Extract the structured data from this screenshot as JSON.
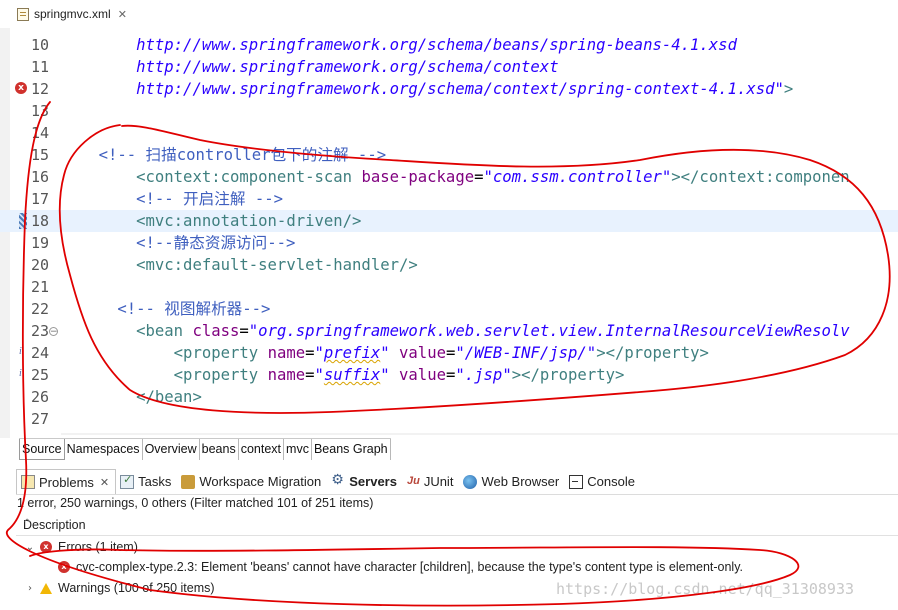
{
  "editor_tab": {
    "title": "springmvc.xml",
    "close": "✕"
  },
  "code_lines": [
    {
      "num": "10",
      "hl": false,
      "segs": [
        {
          "t": "        ",
          "c": "bl"
        },
        {
          "t": "http://www.springframework.org/schema/beans/spring-beans-4.1.xsd",
          "c": "url"
        }
      ]
    },
    {
      "num": "11",
      "hl": false,
      "segs": [
        {
          "t": "        ",
          "c": "bl"
        },
        {
          "t": "http://www.springframework.org/schema/context",
          "c": "url"
        }
      ]
    },
    {
      "num": "12",
      "hl": false,
      "segs": [
        {
          "t": "        ",
          "c": "bl"
        },
        {
          "t": "http://www.springframework.org/schema/context/spring-context-4.1.xsd\"",
          "c": "url"
        },
        {
          "t": ">",
          "c": "tag"
        }
      ]
    },
    {
      "num": "13",
      "hl": false,
      "segs": []
    },
    {
      "num": "14",
      "hl": false,
      "segs": []
    },
    {
      "num": "15",
      "hl": false,
      "segs": [
        {
          "t": "    ",
          "c": "bl"
        },
        {
          "t": "<!-- 扫描controller包下的注解 -->",
          "c": "cmt"
        }
      ]
    },
    {
      "num": "16",
      "hl": false,
      "segs": [
        {
          "t": "        ",
          "c": "bl"
        },
        {
          "t": "<context:component-scan ",
          "c": "tag"
        },
        {
          "t": "base-package",
          "c": "attr"
        },
        {
          "t": "=",
          "c": "bl"
        },
        {
          "t": "\"com.ssm.controller\"",
          "c": "str"
        },
        {
          "t": "></context:componen",
          "c": "tag"
        }
      ]
    },
    {
      "num": "17",
      "hl": false,
      "segs": [
        {
          "t": "        ",
          "c": "bl"
        },
        {
          "t": "<!-- 开启注解 -->",
          "c": "cmt"
        }
      ]
    },
    {
      "num": "18",
      "hl": true,
      "segs": [
        {
          "t": "        ",
          "c": "bl"
        },
        {
          "t": "<mvc:annotation-driven/>",
          "c": "tag"
        }
      ]
    },
    {
      "num": "19",
      "hl": false,
      "segs": [
        {
          "t": "        ",
          "c": "bl"
        },
        {
          "t": "<!--静态资源访问-->",
          "c": "cmt"
        }
      ]
    },
    {
      "num": "20",
      "hl": false,
      "segs": [
        {
          "t": "        ",
          "c": "bl"
        },
        {
          "t": "<mvc:default-servlet-handler/>",
          "c": "tag"
        }
      ]
    },
    {
      "num": "21",
      "hl": false,
      "segs": []
    },
    {
      "num": "22",
      "hl": false,
      "segs": [
        {
          "t": "      ",
          "c": "bl"
        },
        {
          "t": "<!-- 视图解析器-->",
          "c": "cmt"
        }
      ]
    },
    {
      "num": "23",
      "hl": false,
      "segs": [
        {
          "t": "        ",
          "c": "bl"
        },
        {
          "t": "<bean ",
          "c": "tag"
        },
        {
          "t": "class",
          "c": "attr"
        },
        {
          "t": "=",
          "c": "bl"
        },
        {
          "t": "\"org.springframework.web.servlet.view.InternalResourceViewResolv",
          "c": "str"
        }
      ]
    },
    {
      "num": "24",
      "hl": false,
      "segs": [
        {
          "t": "            ",
          "c": "bl"
        },
        {
          "t": "<property ",
          "c": "tag"
        },
        {
          "t": "name",
          "c": "attr"
        },
        {
          "t": "=",
          "c": "bl"
        },
        {
          "t": "\"",
          "c": "str"
        },
        {
          "t": "prefix",
          "c": "str",
          "sq": true
        },
        {
          "t": "\" ",
          "c": "str"
        },
        {
          "t": "value",
          "c": "attr"
        },
        {
          "t": "=",
          "c": "bl"
        },
        {
          "t": "\"/WEB-INF/jsp/\"",
          "c": "str"
        },
        {
          "t": "></property>",
          "c": "tag"
        }
      ]
    },
    {
      "num": "25",
      "hl": false,
      "segs": [
        {
          "t": "            ",
          "c": "bl"
        },
        {
          "t": "<property ",
          "c": "tag"
        },
        {
          "t": "name",
          "c": "attr"
        },
        {
          "t": "=",
          "c": "bl"
        },
        {
          "t": "\"",
          "c": "str"
        },
        {
          "t": "suffix",
          "c": "str",
          "sq": true
        },
        {
          "t": "\" ",
          "c": "str"
        },
        {
          "t": "value",
          "c": "attr"
        },
        {
          "t": "=",
          "c": "bl"
        },
        {
          "t": "\".jsp\"",
          "c": "str"
        },
        {
          "t": "></property>",
          "c": "tag"
        }
      ]
    },
    {
      "num": "26",
      "hl": false,
      "segs": [
        {
          "t": "        ",
          "c": "bl"
        },
        {
          "t": "</bean>",
          "c": "tag"
        }
      ]
    },
    {
      "num": "27",
      "hl": false,
      "segs": []
    }
  ],
  "gutter": {
    "error_line": "12",
    "bookmark_line": "18",
    "fold_lines": [
      "23"
    ],
    "info_lines": [
      "24",
      "25"
    ],
    "error_glyph": "x",
    "fold_glyph": "−",
    "info_glyph": "i"
  },
  "page_tabs": [
    {
      "label": "Source",
      "active": true
    },
    {
      "label": "Namespaces",
      "active": false
    },
    {
      "label": "Overview",
      "active": false
    },
    {
      "label": "beans",
      "active": false
    },
    {
      "label": "context",
      "active": false
    },
    {
      "label": "mvc",
      "active": false
    },
    {
      "label": "Beans Graph",
      "active": false
    }
  ],
  "view_tabs": [
    {
      "label": "Problems",
      "icon": "problems-icon",
      "active": true,
      "close": "✕"
    },
    {
      "label": "Tasks",
      "icon": "tasks-icon"
    },
    {
      "label": "Workspace Migration",
      "icon": "workspace-migration-icon"
    },
    {
      "label": "Servers",
      "icon": "servers-icon",
      "bold": true
    },
    {
      "label": "JUnit",
      "icon": "junit-icon",
      "icon_text": "Ju"
    },
    {
      "label": "Web Browser",
      "icon": "web-browser-icon"
    },
    {
      "label": "Console",
      "icon": "console-icon"
    }
  ],
  "problems": {
    "summary": "1 error, 250 warnings, 0 others (Filter matched 101 of 251 items)",
    "column_header": "Description",
    "sort_caret": "^",
    "errors_group": {
      "chevron": "⌄",
      "label": "Errors (1 item)"
    },
    "error_item": "cvc-complex-type.2.3: Element 'beans' cannot have character [children], because the type's content type is element-only.",
    "warnings_group": {
      "chevron": "›",
      "label": "Warnings (100 of 250 items)"
    }
  },
  "watermark": "https://blog.csdn.net/qq_31308933",
  "annotation_color": "#e00000"
}
